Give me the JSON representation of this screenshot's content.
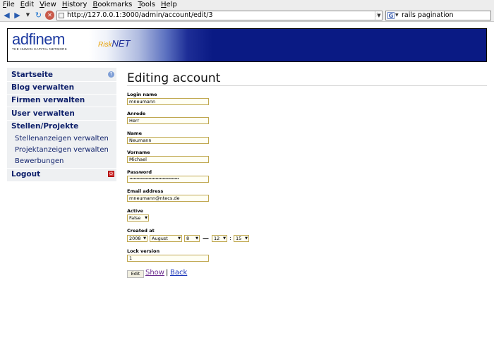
{
  "browser": {
    "menu": [
      "File",
      "Edit",
      "View",
      "History",
      "Bookmarks",
      "Tools",
      "Help"
    ],
    "url": "http://127.0.0.1:3000/admin/account/edit/3",
    "search_text": "rails pagination"
  },
  "banner": {
    "logo_brand": "adfinem",
    "logo_tagline": "The Human Capital Network",
    "risk": "Risk",
    "net": "NET"
  },
  "sidebar": {
    "items": [
      {
        "label": "Startseite",
        "icon": "arrow-up-icon"
      },
      {
        "label": "Blog verwalten"
      },
      {
        "label": "Firmen verwalten"
      },
      {
        "label": "User verwalten"
      },
      {
        "label": "Stellen/Projekte"
      },
      {
        "label": "Stellenanzeigen verwalten"
      },
      {
        "label": "Projektanzeigen verwalten"
      },
      {
        "label": "Bewerbungen"
      },
      {
        "label": "Logout",
        "icon": "power-icon"
      }
    ]
  },
  "page": {
    "title": "Editing account"
  },
  "form": {
    "login_name": {
      "label": "Login name",
      "value": "mneumann"
    },
    "anrede": {
      "label": "Anrede",
      "value": "Herr"
    },
    "name": {
      "label": "Name",
      "value": "Neumann"
    },
    "vorname": {
      "label": "Vorname",
      "value": "Michael"
    },
    "password": {
      "label": "Password",
      "value": "••••••••••••••••••••••••••••••••••••"
    },
    "email": {
      "label": "Email address",
      "value": "mneumann@ntecs.de"
    },
    "active": {
      "label": "Active",
      "value": "False"
    },
    "created_at": {
      "label": "Created at",
      "year": "2008",
      "month": "August",
      "day": "8",
      "hour": "12",
      "minute": "15",
      "dash": "—",
      "colon": ":"
    },
    "lock_version": {
      "label": "Lock version",
      "value": "1"
    },
    "edit_label": "Edit",
    "show_label": "Show",
    "separator": "|",
    "back_label": "Back"
  },
  "colors": {
    "nav_text": "#0d1f6a",
    "field_bg": "#fffff4",
    "field_border": "#c0a850",
    "link": "#1a35b8",
    "link_visited": "#6a2c8e"
  }
}
